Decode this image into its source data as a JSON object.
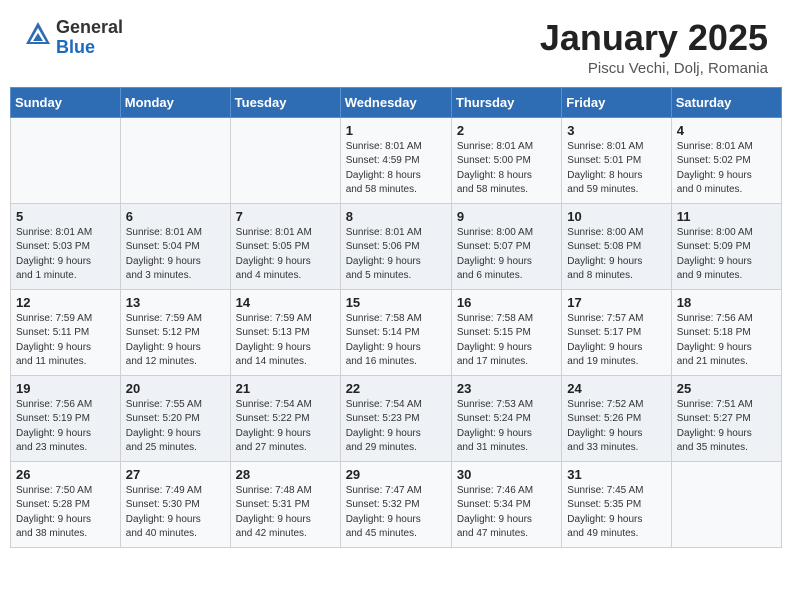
{
  "header": {
    "logo_general": "General",
    "logo_blue": "Blue",
    "month_title": "January 2025",
    "location": "Piscu Vechi, Dolj, Romania"
  },
  "weekdays": [
    "Sunday",
    "Monday",
    "Tuesday",
    "Wednesday",
    "Thursday",
    "Friday",
    "Saturday"
  ],
  "weeks": [
    [
      {
        "day": "",
        "info": ""
      },
      {
        "day": "",
        "info": ""
      },
      {
        "day": "",
        "info": ""
      },
      {
        "day": "1",
        "info": "Sunrise: 8:01 AM\nSunset: 4:59 PM\nDaylight: 8 hours\nand 58 minutes."
      },
      {
        "day": "2",
        "info": "Sunrise: 8:01 AM\nSunset: 5:00 PM\nDaylight: 8 hours\nand 58 minutes."
      },
      {
        "day": "3",
        "info": "Sunrise: 8:01 AM\nSunset: 5:01 PM\nDaylight: 8 hours\nand 59 minutes."
      },
      {
        "day": "4",
        "info": "Sunrise: 8:01 AM\nSunset: 5:02 PM\nDaylight: 9 hours\nand 0 minutes."
      }
    ],
    [
      {
        "day": "5",
        "info": "Sunrise: 8:01 AM\nSunset: 5:03 PM\nDaylight: 9 hours\nand 1 minute."
      },
      {
        "day": "6",
        "info": "Sunrise: 8:01 AM\nSunset: 5:04 PM\nDaylight: 9 hours\nand 3 minutes."
      },
      {
        "day": "7",
        "info": "Sunrise: 8:01 AM\nSunset: 5:05 PM\nDaylight: 9 hours\nand 4 minutes."
      },
      {
        "day": "8",
        "info": "Sunrise: 8:01 AM\nSunset: 5:06 PM\nDaylight: 9 hours\nand 5 minutes."
      },
      {
        "day": "9",
        "info": "Sunrise: 8:00 AM\nSunset: 5:07 PM\nDaylight: 9 hours\nand 6 minutes."
      },
      {
        "day": "10",
        "info": "Sunrise: 8:00 AM\nSunset: 5:08 PM\nDaylight: 9 hours\nand 8 minutes."
      },
      {
        "day": "11",
        "info": "Sunrise: 8:00 AM\nSunset: 5:09 PM\nDaylight: 9 hours\nand 9 minutes."
      }
    ],
    [
      {
        "day": "12",
        "info": "Sunrise: 7:59 AM\nSunset: 5:11 PM\nDaylight: 9 hours\nand 11 minutes."
      },
      {
        "day": "13",
        "info": "Sunrise: 7:59 AM\nSunset: 5:12 PM\nDaylight: 9 hours\nand 12 minutes."
      },
      {
        "day": "14",
        "info": "Sunrise: 7:59 AM\nSunset: 5:13 PM\nDaylight: 9 hours\nand 14 minutes."
      },
      {
        "day": "15",
        "info": "Sunrise: 7:58 AM\nSunset: 5:14 PM\nDaylight: 9 hours\nand 16 minutes."
      },
      {
        "day": "16",
        "info": "Sunrise: 7:58 AM\nSunset: 5:15 PM\nDaylight: 9 hours\nand 17 minutes."
      },
      {
        "day": "17",
        "info": "Sunrise: 7:57 AM\nSunset: 5:17 PM\nDaylight: 9 hours\nand 19 minutes."
      },
      {
        "day": "18",
        "info": "Sunrise: 7:56 AM\nSunset: 5:18 PM\nDaylight: 9 hours\nand 21 minutes."
      }
    ],
    [
      {
        "day": "19",
        "info": "Sunrise: 7:56 AM\nSunset: 5:19 PM\nDaylight: 9 hours\nand 23 minutes."
      },
      {
        "day": "20",
        "info": "Sunrise: 7:55 AM\nSunset: 5:20 PM\nDaylight: 9 hours\nand 25 minutes."
      },
      {
        "day": "21",
        "info": "Sunrise: 7:54 AM\nSunset: 5:22 PM\nDaylight: 9 hours\nand 27 minutes."
      },
      {
        "day": "22",
        "info": "Sunrise: 7:54 AM\nSunset: 5:23 PM\nDaylight: 9 hours\nand 29 minutes."
      },
      {
        "day": "23",
        "info": "Sunrise: 7:53 AM\nSunset: 5:24 PM\nDaylight: 9 hours\nand 31 minutes."
      },
      {
        "day": "24",
        "info": "Sunrise: 7:52 AM\nSunset: 5:26 PM\nDaylight: 9 hours\nand 33 minutes."
      },
      {
        "day": "25",
        "info": "Sunrise: 7:51 AM\nSunset: 5:27 PM\nDaylight: 9 hours\nand 35 minutes."
      }
    ],
    [
      {
        "day": "26",
        "info": "Sunrise: 7:50 AM\nSunset: 5:28 PM\nDaylight: 9 hours\nand 38 minutes."
      },
      {
        "day": "27",
        "info": "Sunrise: 7:49 AM\nSunset: 5:30 PM\nDaylight: 9 hours\nand 40 minutes."
      },
      {
        "day": "28",
        "info": "Sunrise: 7:48 AM\nSunset: 5:31 PM\nDaylight: 9 hours\nand 42 minutes."
      },
      {
        "day": "29",
        "info": "Sunrise: 7:47 AM\nSunset: 5:32 PM\nDaylight: 9 hours\nand 45 minutes."
      },
      {
        "day": "30",
        "info": "Sunrise: 7:46 AM\nSunset: 5:34 PM\nDaylight: 9 hours\nand 47 minutes."
      },
      {
        "day": "31",
        "info": "Sunrise: 7:45 AM\nSunset: 5:35 PM\nDaylight: 9 hours\nand 49 minutes."
      },
      {
        "day": "",
        "info": ""
      }
    ]
  ]
}
